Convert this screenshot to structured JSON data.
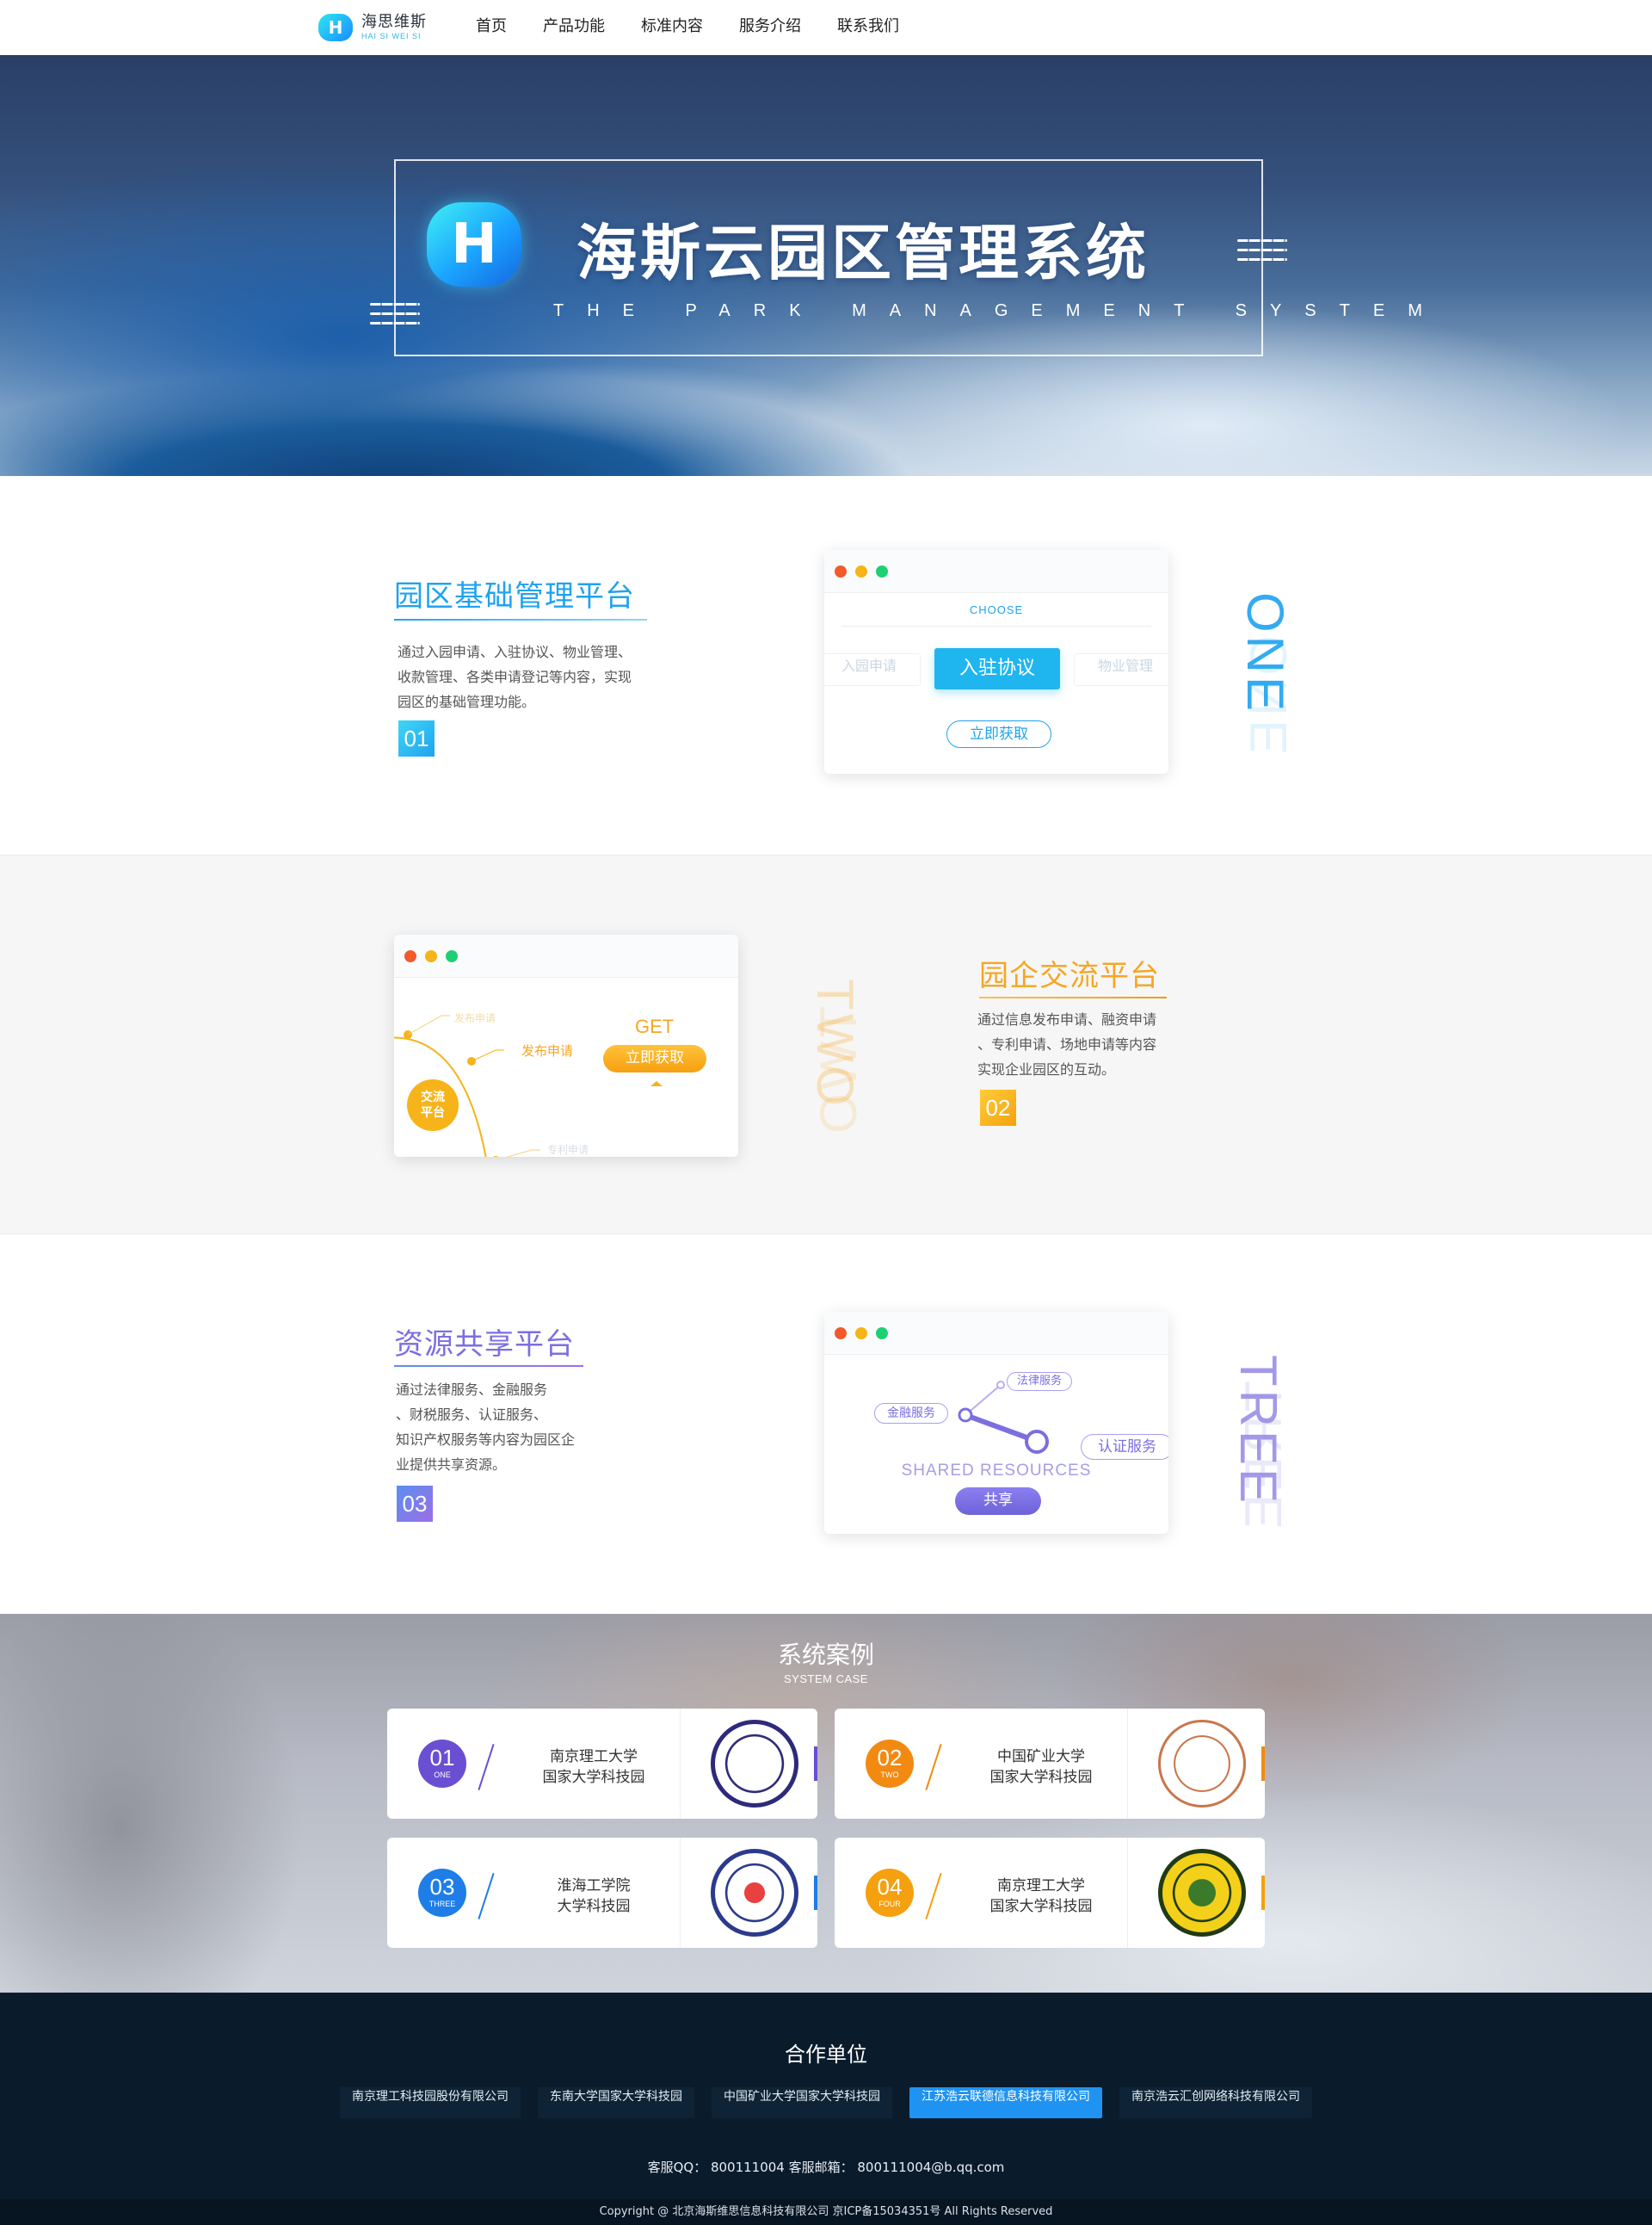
{
  "brand": {
    "name_cn": "海思维斯",
    "name_en": "HAI SI WEI SI",
    "logo_letter": "H",
    "color_primary": "#1fb6ef"
  },
  "nav": {
    "items": [
      "首页",
      "产品功能",
      "标准内容",
      "服务介绍",
      "联系我们"
    ]
  },
  "hero": {
    "title": "海斯云园区管理系统",
    "subtitle": "THE PARK MANAGEMENT SYSTEM",
    "logo_letter": "H"
  },
  "features": [
    {
      "title": "园区基础管理平台",
      "desc": [
        "通过入园申请、入驻协议、物业管理、",
        "收款管理、各类申请登记等内容，实现",
        "园区的基础管理功能。"
      ],
      "num": "01",
      "vertical_word": "ONE",
      "color": "#1fb6ef",
      "window": {
        "choose": "CHOOSE",
        "chips": [
          "入园申请",
          "入驻协议",
          "物业管理"
        ],
        "button": "立即获取"
      }
    },
    {
      "title": "园企交流平台",
      "desc": [
        "通过信息发布申请、融资申请",
        "、专利申请、场地申请等内容",
        "实现企业园区的互动。"
      ],
      "num": "02",
      "vertical_word": "TWO",
      "color": "#f6a623",
      "window": {
        "badge": "交流\n平台",
        "labels": [
          "发布申请",
          "发布申请",
          "专利申请"
        ],
        "get": "GET",
        "button": "立即获取"
      }
    },
    {
      "title": "资源共享平台",
      "desc": [
        "通过法律服务、金融服务",
        "、财税服务、认证服务、",
        "知识产权服务等内容为园区企",
        "业提供共享资源。"
      ],
      "num": "03",
      "vertical_word": "TREE",
      "color": "#7b6fe0",
      "window": {
        "tags": [
          "法律服务",
          "金融服务",
          "认证服务"
        ],
        "caption": "SHARED RESOURCES",
        "button": "共享"
      }
    }
  ],
  "cases": {
    "title": "系统案例",
    "subtitle": "SYSTEM CASE",
    "items": [
      {
        "num": "01",
        "word": "ONE",
        "line1": "南京理工大学",
        "line2": "国家大学科技园",
        "color": "#6a4fd3",
        "seal_color": "#2e2a7a"
      },
      {
        "num": "02",
        "word": "TWO",
        "line1": "中国矿业大学",
        "line2": "国家大学科技园",
        "color": "#f28a12",
        "seal_color": "#c9764a"
      },
      {
        "num": "03",
        "word": "THREE",
        "line1": "淮海工学院",
        "line2": "大学科技园",
        "color": "#1f7de8",
        "seal_color": "#2b3a8c"
      },
      {
        "num": "04",
        "word": "FOUR",
        "line1": "南京理工大学",
        "line2": "国家大学科技园",
        "color": "#f5a00f",
        "seal_color": "#3a7a2a"
      }
    ]
  },
  "footer": {
    "partners_title": "合作单位",
    "partners": [
      "南京理工科技园股份有限公司",
      "东南大学国家大学科技园",
      "中国矿业大学国家大学科技园",
      "江苏浩云联德信息科技有限公司",
      "南京浩云汇创网络科技有限公司"
    ],
    "active_partner_index": 3,
    "contact": "客服QQ：  800111004    客服邮箱：  800111004@b.qq.com",
    "copyright": "Copyright @ 北京海斯维思信息科技有限公司      京ICP备15034351号      All Rights Reserved"
  }
}
